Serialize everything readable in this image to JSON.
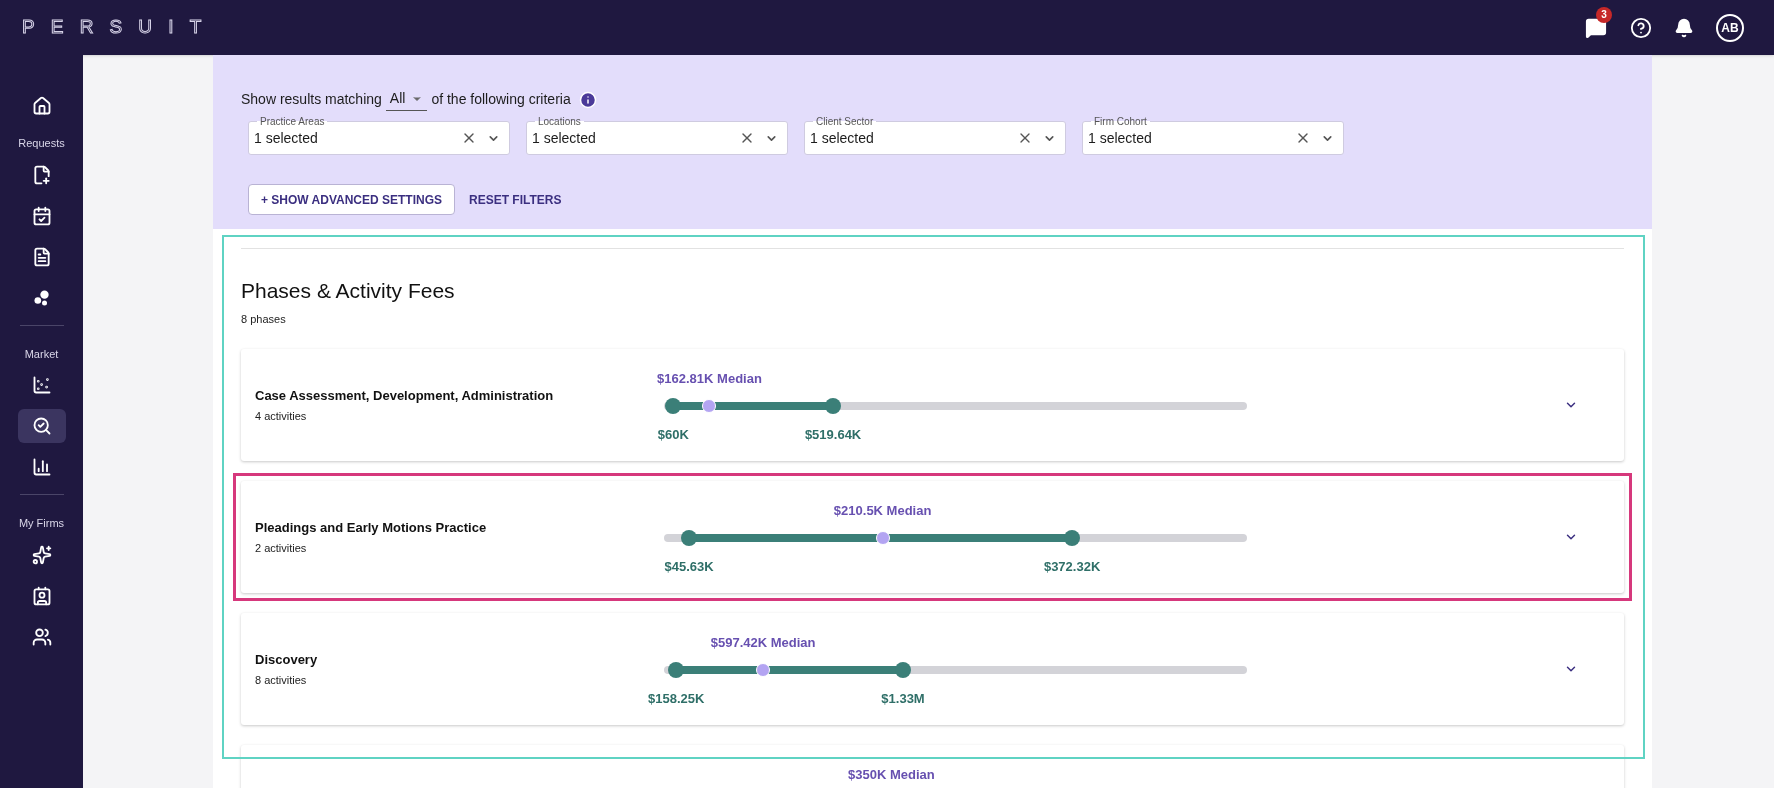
{
  "brand": "PERSUIT",
  "topbar": {
    "messages_badge": "3",
    "avatar": "AB"
  },
  "sidebar": {
    "home": {
      "selected": false
    },
    "sections": [
      {
        "label": "Requests",
        "items": [
          {
            "selected": false
          },
          {
            "selected": false
          },
          {
            "selected": false
          },
          {
            "selected": false
          }
        ]
      },
      {
        "label": "Market",
        "items": [
          {
            "selected": false
          },
          {
            "selected": true
          },
          {
            "selected": false
          }
        ]
      },
      {
        "label": "My Firms",
        "items": [
          {
            "selected": false
          },
          {
            "selected": false
          },
          {
            "selected": false
          }
        ]
      }
    ]
  },
  "filters": {
    "prefix": "Show results matching",
    "match": "All",
    "suffix": "of the following criteria",
    "fields": [
      {
        "label": "Practice Areas",
        "value": "1 selected"
      },
      {
        "label": "Locations",
        "value": "1 selected"
      },
      {
        "label": "Client Sector",
        "value": "1 selected"
      },
      {
        "label": "Firm Cohort",
        "value": "1 selected"
      }
    ],
    "advanced_button": "+ SHOW ADVANCED SETTINGS",
    "reset_button": "RESET FILTERS"
  },
  "section": {
    "title": "Phases & Activity Fees",
    "subtitle": "8 phases"
  },
  "phases": [
    {
      "name": "Case Assessment, Development, Administration",
      "activities": "4 activities",
      "highlighted": false,
      "low": {
        "label": "$60K",
        "level": 0.016
      },
      "median": {
        "label": "$162.81K Median",
        "level": 0.078
      },
      "high": {
        "label": "$519.64K",
        "level": 0.29
      }
    },
    {
      "name": "Pleadings and Early Motions Practice",
      "activities": "2 activities",
      "highlighted": true,
      "low": {
        "label": "$45.63K",
        "level": 0.043
      },
      "median": {
        "label": "$210.5K Median",
        "level": 0.375
      },
      "high": {
        "label": "$372.32K",
        "level": 0.7
      }
    },
    {
      "name": "Discovery",
      "activities": "8 activities",
      "highlighted": false,
      "low": {
        "label": "$158.25K",
        "level": 0.021
      },
      "median": {
        "label": "$597.42K Median",
        "level": 0.17
      },
      "high": {
        "label": "$1.33M",
        "level": 0.41
      }
    },
    {
      "median": {
        "label": "$350K Median"
      }
    }
  ]
}
